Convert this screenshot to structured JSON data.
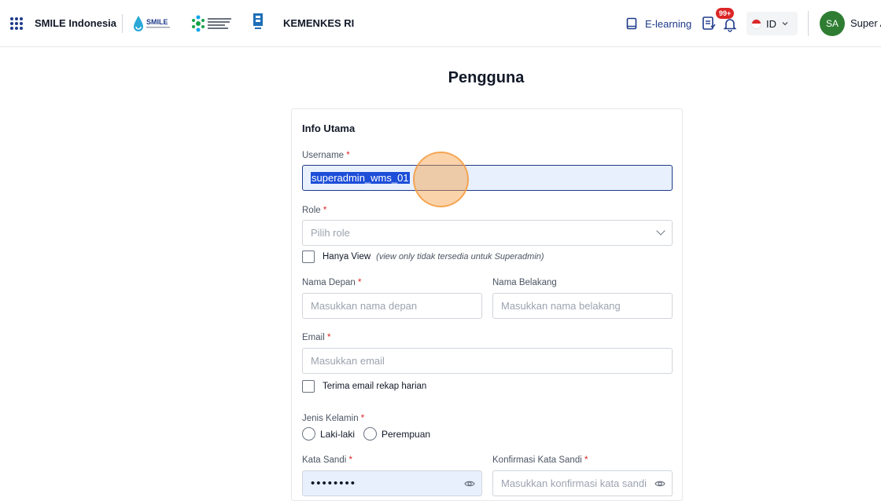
{
  "header": {
    "app_name": "SMILE Indonesia",
    "org_name": "KEMENKES RI",
    "elearning_label": "E-learning",
    "notification_count": "99+",
    "language": "ID",
    "avatar_initials": "SA",
    "user_name": "Super A",
    "logo_smile_text": "SMILE",
    "logo_kemenkes_text": "KEMENTERIAN KESEHATAN REPUBLIK INDONESIA",
    "icons": [
      "apps-grid-icon",
      "book-icon",
      "task-list-icon",
      "bell-icon",
      "indonesia-flag-icon",
      "chevron-down-icon"
    ]
  },
  "page": {
    "title": "Pengguna"
  },
  "form": {
    "section_title": "Info Utama",
    "required_mark": "*",
    "username": {
      "label": "Username",
      "value": "superadmin_wms_01"
    },
    "role": {
      "label": "Role",
      "placeholder": "Pilih role"
    },
    "view_only": {
      "label": "Hanya View",
      "note": "(view only tidak tersedia untuk Superadmin)"
    },
    "first_name": {
      "label": "Nama Depan",
      "placeholder": "Masukkan nama depan"
    },
    "last_name": {
      "label": "Nama Belakang",
      "placeholder": "Masukkan nama belakang"
    },
    "email": {
      "label": "Email",
      "placeholder": "Masukkan email"
    },
    "daily_email": {
      "label": "Terima email rekap harian"
    },
    "gender": {
      "label": "Jenis Kelamin",
      "options": [
        "Laki-laki",
        "Perempuan"
      ]
    },
    "password": {
      "label": "Kata Sandi",
      "value": "••••••••"
    },
    "confirm_password": {
      "label": "Konfirmasi Kata Sandi",
      "placeholder": "Masukkan konfirmasi kata sandi"
    }
  },
  "colors": {
    "primary": "#1e3a8a",
    "badge": "#dc2626",
    "avatar": "#2e7d32",
    "required": "#dc2626",
    "click_indicator": "#f59e42"
  }
}
